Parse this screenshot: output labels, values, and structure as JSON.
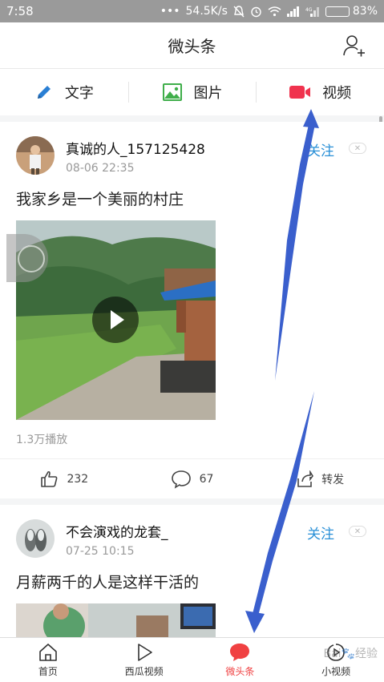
{
  "status_bar": {
    "time": "7:58",
    "network_speed": "54.5K/s",
    "battery": "83%",
    "battery_level": 0.83
  },
  "header": {
    "title": "微头条",
    "add_user_icon": "add-user-icon"
  },
  "publish_bar": {
    "options": [
      {
        "label": "文字",
        "icon": "pencil-icon",
        "color": "#2a7fd4"
      },
      {
        "label": "图片",
        "icon": "image-icon",
        "color": "#3fae4a"
      },
      {
        "label": "视频",
        "icon": "video-camera-icon",
        "color": "#f0334e"
      }
    ]
  },
  "feed": {
    "posts": [
      {
        "author": "真诚的人_157125428",
        "time": "08-06 22:35",
        "follow_label": "关注",
        "text": "我家乡是一个美丽的村庄",
        "views": "1.3万播放",
        "likes": "232",
        "comments": "67",
        "share_label": "转发"
      },
      {
        "author": "不会演戏的龙套_",
        "time": "07-25 10:15",
        "follow_label": "关注",
        "text": "月薪两千的人是这样干活的"
      }
    ]
  },
  "bottom_nav": {
    "tabs": [
      {
        "label": "首页",
        "icon": "home-icon",
        "active": false
      },
      {
        "label": "西瓜视频",
        "icon": "play-icon",
        "active": false
      },
      {
        "label": "微头条",
        "icon": "chat-bubble-icon",
        "active": true
      },
      {
        "label": "小视频",
        "icon": "short-video-icon",
        "active": false
      }
    ]
  },
  "colors": {
    "accent_red": "#f04142",
    "follow_blue": "#2a90d7",
    "annotation_arrow": "#3a5fcd"
  }
}
